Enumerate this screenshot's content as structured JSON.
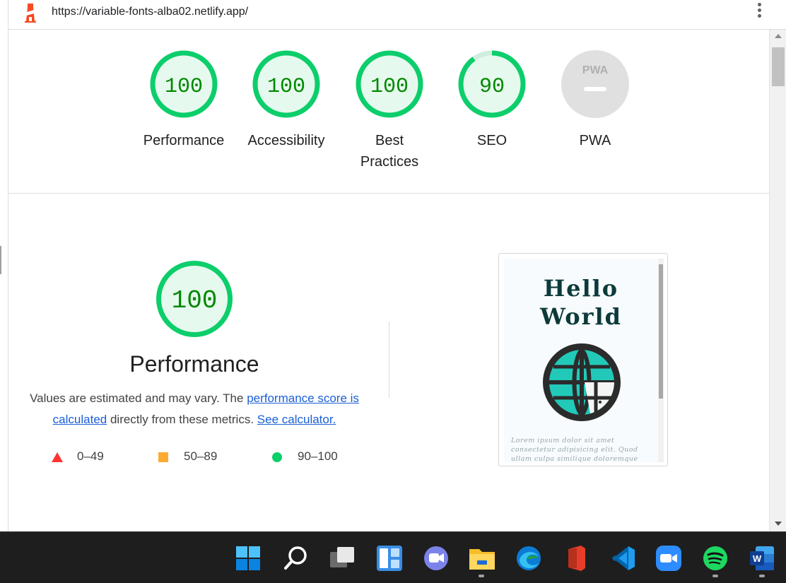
{
  "browser": {
    "url": "https://variable-fonts-alba02.netlify.app/"
  },
  "gauges": [
    {
      "label": "Performance",
      "score": "100",
      "fraction": 1.0
    },
    {
      "label": "Accessibility",
      "score": "100",
      "fraction": 1.0
    },
    {
      "label": "Best\nPractices",
      "score": "100",
      "fraction": 1.0
    },
    {
      "label": "SEO",
      "score": "90",
      "fraction": 0.9
    },
    {
      "label": "PWA",
      "score": "",
      "fraction": 0
    }
  ],
  "pwa_badge": "PWA",
  "performance": {
    "score": "100",
    "title": "Performance",
    "desc_prefix": "Values are estimated and may vary. The ",
    "link1": "performance score is calculated",
    "desc_middle": " directly from these metrics. ",
    "link2": "See calculator.",
    "legend": [
      {
        "range": "0–49",
        "shape": "triangle",
        "color": "#ff3333"
      },
      {
        "range": "50–89",
        "shape": "square",
        "color": "#ffaa33"
      },
      {
        "range": "90–100",
        "shape": "circle",
        "color": "#0cce6b"
      }
    ]
  },
  "thumbnail": {
    "heading_line1": "Hello",
    "heading_line2": "World",
    "lorem": "Lorem ipsum dolor sit amet consectetur adipisicing elit. Quod ullam culpa similique doloremque"
  },
  "colors": {
    "pass": "#0cce6b",
    "pass_fill": "#e6f9ee",
    "pass_text": "#008800",
    "link": "#1a5fd6",
    "taskbar": "#1f1e1e"
  },
  "taskbar": {
    "apps": [
      "start-icon",
      "search-icon",
      "task-view-icon",
      "widgets-icon",
      "teams-chat-icon",
      "file-explorer-icon",
      "edge-icon",
      "office-icon",
      "vscode-icon",
      "zoom-icon",
      "spotify-icon",
      "word-icon"
    ]
  }
}
